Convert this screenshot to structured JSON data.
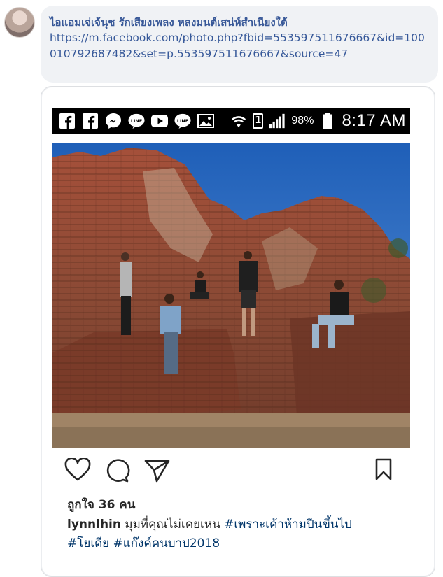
{
  "comment": {
    "author": "ไอแอมเจ่เจ้นุช รักเสียงเพลง หลงมนต์เสน่ห์สำเนียงใต้",
    "link": "https://m.facebook.com/photo.php?fbid=553597511676667&id=100010792687482&set=p.553597511676667&source=47"
  },
  "statusbar": {
    "icons": [
      "facebook-icon",
      "facebook-icon",
      "messenger-icon",
      "line-icon",
      "youtube-icon",
      "line-icon",
      "gallery-icon",
      "wifi-icon",
      "sim-icon",
      "signal-icon",
      "battery-icon"
    ],
    "sim": "1",
    "battery": "98%",
    "time": "8:17 AM"
  },
  "post": {
    "likes": "ถูกใจ 36 คน",
    "username": "lynnlhin",
    "caption_text": " มุมที่คุณไม่เคยเหน ",
    "hashtags": [
      "#เพราะเค้าห้ามปีนขึ้นไป",
      "#โยเดีย",
      "#แก๊งค์คนบาป2018"
    ]
  },
  "colors": {
    "link": "#385898",
    "bubble": "#f0f2f5",
    "hashtag": "#003569"
  }
}
